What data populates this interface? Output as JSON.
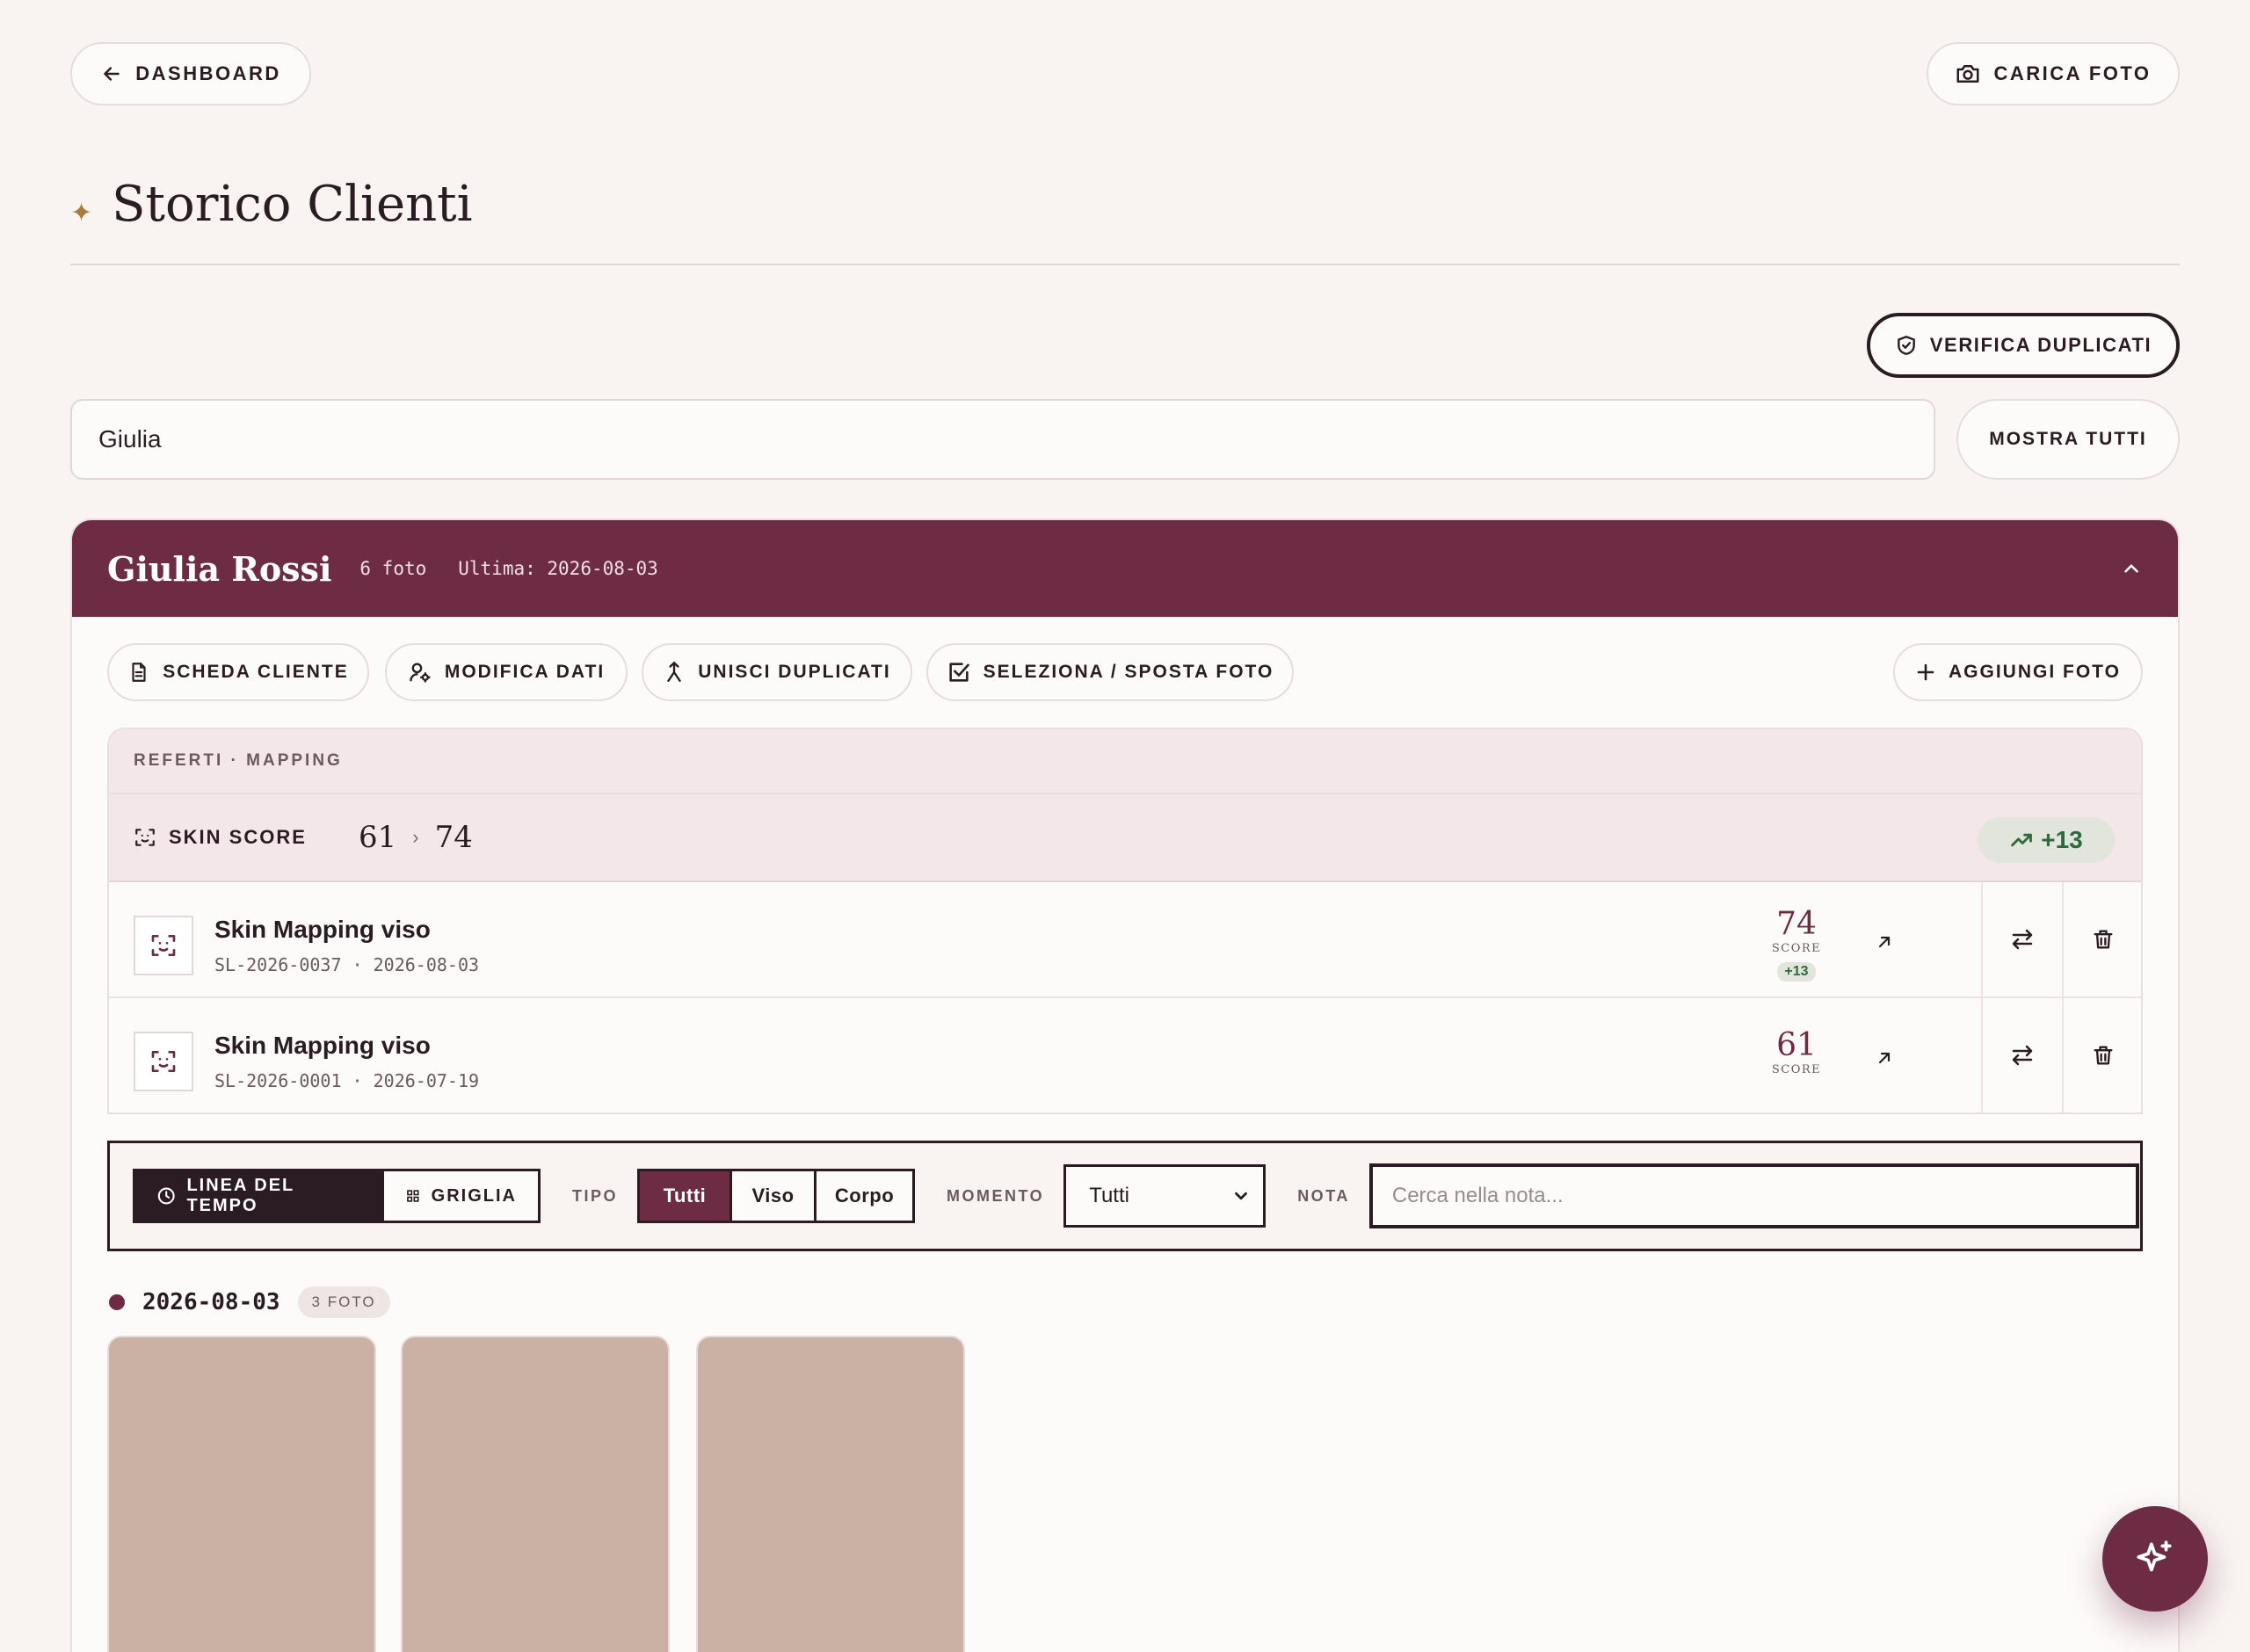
{
  "top_nav": {
    "back_label": "DASHBOARD",
    "upload_label": "CARICA FOTO"
  },
  "page": {
    "title": "Storico Clienti",
    "title_ornament": "✦"
  },
  "actions": {
    "verify_duplicates_label": "VERIFICA DUPLICATI",
    "show_all_label": "MOSTRA TUTTI"
  },
  "search": {
    "value": "Giulia"
  },
  "client": {
    "name": "Giulia Rossi",
    "photo_count": "6 foto",
    "last": "Ultima: 2026-08-03",
    "actions": {
      "scheda": "SCHEDA CLIENTE",
      "modifica": "MODIFICA DATI",
      "unisci": "UNISCI DUPLICATI",
      "seleziona": "SELEZIONA / SPOSTA FOTO",
      "aggiungi": "AGGIUNGI FOTO"
    }
  },
  "referti": {
    "heading": "REFERTI · MAPPING",
    "skin_score": {
      "label": "SKIN SCORE",
      "from": "61",
      "to": "74",
      "delta": "+13"
    },
    "reports": [
      {
        "title": "Skin Mapping viso",
        "sub": "SL-2026-0037 · 2026-08-03",
        "score": "74",
        "score_label": "SCORE",
        "delta": "+13"
      },
      {
        "title": "Skin Mapping viso",
        "sub": "SL-2026-0001 · 2026-07-19",
        "score": "61",
        "score_label": "SCORE"
      }
    ]
  },
  "filters": {
    "view_timeline": "LINEA DEL TEMPO",
    "view_grid": "GRIGLIA",
    "type_label": "TIPO",
    "type_options": [
      "Tutti",
      "Viso",
      "Corpo"
    ],
    "moment_label": "MOMENTO",
    "moment_value": "Tutti",
    "note_label": "NOTA",
    "note_placeholder": "Cerca nella nota..."
  },
  "timeline": {
    "date": "2026-08-03",
    "count": "3 FOTO"
  },
  "colors": {
    "accent": "#6e2c44",
    "background": "#f9f4f2",
    "photo_placeholder": "#cbb1a3",
    "positive": "#2e6b3a"
  },
  "icons": [
    "arrow-left-icon",
    "camera-icon",
    "shield-check-icon",
    "chevron-up-icon",
    "document-icon",
    "user-gear-icon",
    "merge-icon",
    "checkbox-icon",
    "plus-icon",
    "face-scan-icon",
    "trending-up-icon",
    "arrow-up-right-icon",
    "swap-icon",
    "trash-icon",
    "clock-icon",
    "grid-icon",
    "chevron-down-icon",
    "sparkles-icon"
  ]
}
